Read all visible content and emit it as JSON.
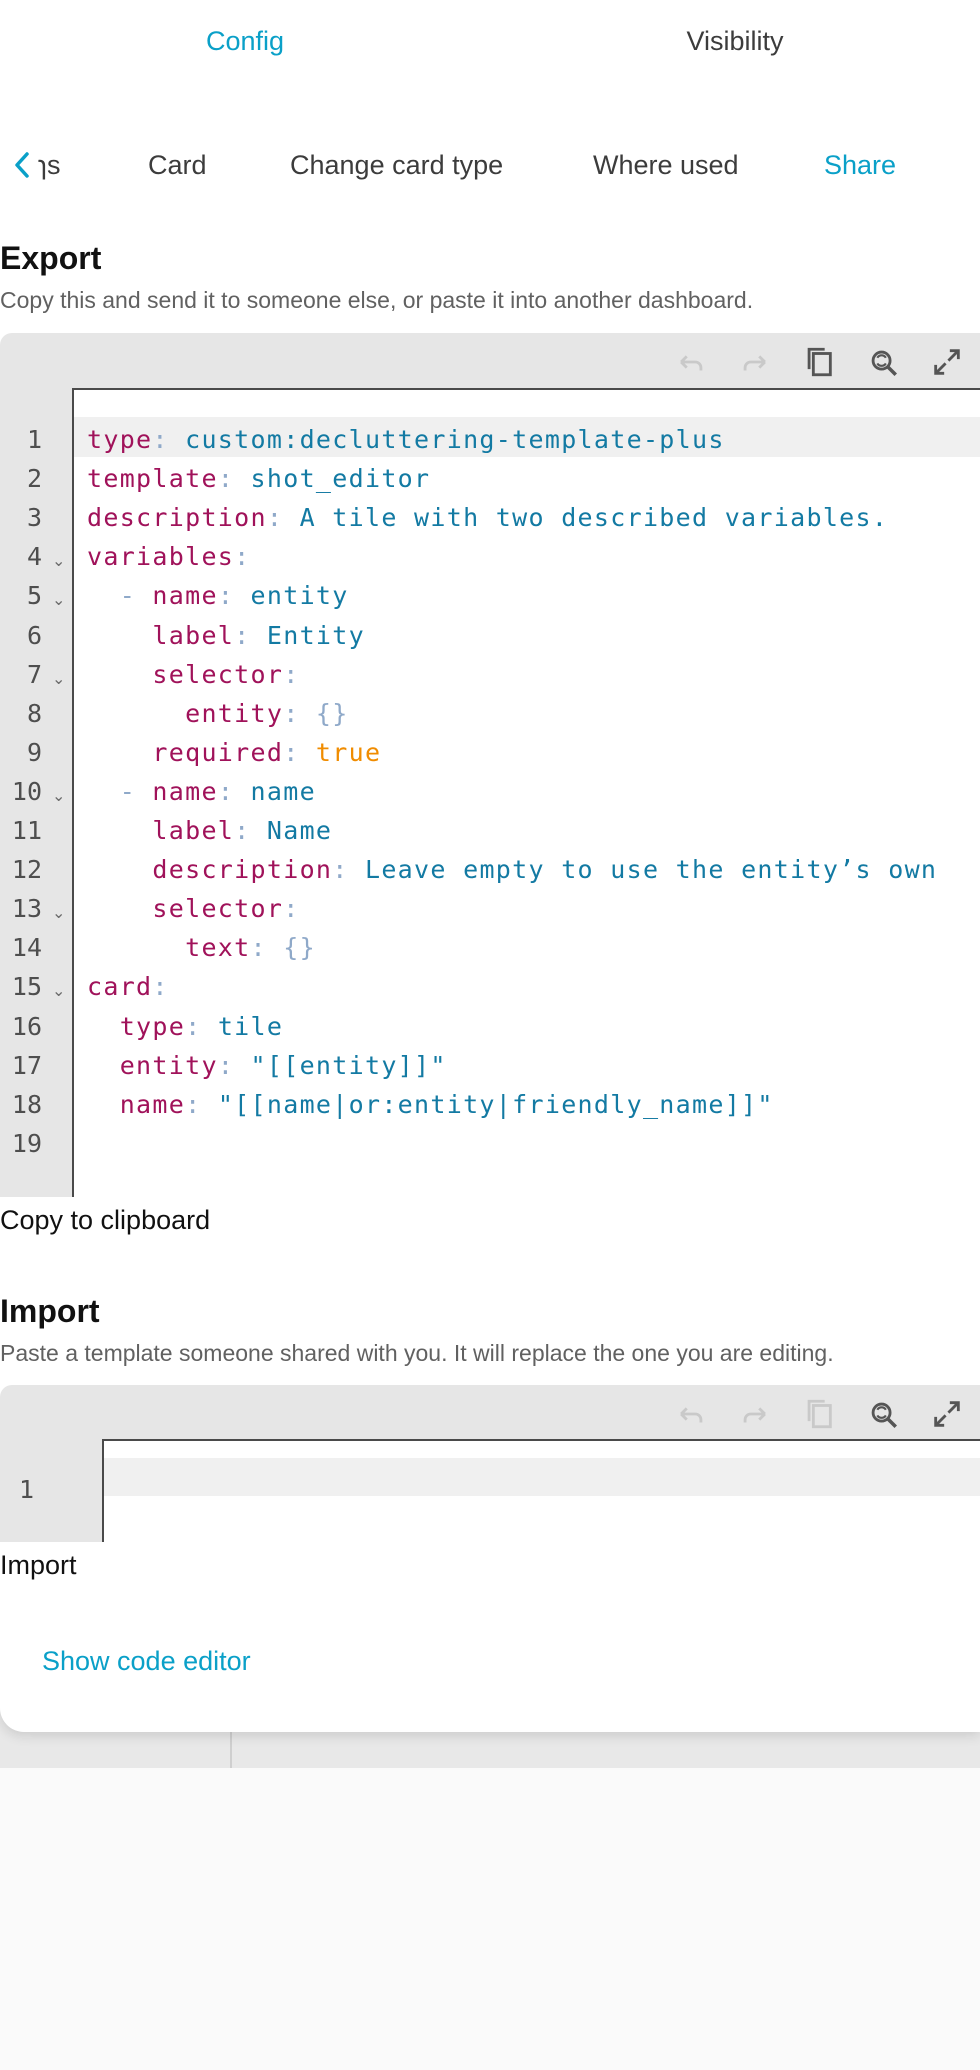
{
  "top_tabs": {
    "config": "Config",
    "visibility": "Visibility"
  },
  "sub_tabs": {
    "partial": "ɿs",
    "card": "Card",
    "change_type": "Change card type",
    "where_used": "Where used",
    "share": "Share"
  },
  "export": {
    "title": "Export",
    "description": "Copy this and send it to someone else, or paste it into another dashboard.",
    "copy_label": "Copy to clipboard",
    "toolbar_icons": [
      "undo-icon",
      "redo-icon",
      "copy-icon",
      "search-replace-icon",
      "fullscreen-icon"
    ],
    "lines": [
      {
        "n": "1",
        "fold": false,
        "parts": [
          [
            "k",
            "type"
          ],
          [
            "p",
            ": "
          ],
          [
            "s",
            "custom:decluttering-template-plus"
          ]
        ]
      },
      {
        "n": "2",
        "fold": false,
        "parts": [
          [
            "k",
            "template"
          ],
          [
            "p",
            ": "
          ],
          [
            "s",
            "shot_editor"
          ]
        ]
      },
      {
        "n": "3",
        "fold": false,
        "parts": [
          [
            "k",
            "description"
          ],
          [
            "p",
            ": "
          ],
          [
            "s",
            "A tile with two described variables."
          ]
        ]
      },
      {
        "n": "4",
        "fold": true,
        "parts": [
          [
            "k",
            "variables"
          ],
          [
            "p",
            ":"
          ]
        ]
      },
      {
        "n": "5",
        "fold": true,
        "parts": [
          [
            "p",
            "  - "
          ],
          [
            "k",
            "name"
          ],
          [
            "p",
            ": "
          ],
          [
            "s",
            "entity"
          ]
        ]
      },
      {
        "n": "6",
        "fold": false,
        "parts": [
          [
            "p",
            "    "
          ],
          [
            "k",
            "label"
          ],
          [
            "p",
            ": "
          ],
          [
            "s",
            "Entity"
          ]
        ]
      },
      {
        "n": "7",
        "fold": true,
        "parts": [
          [
            "p",
            "    "
          ],
          [
            "k",
            "selector"
          ],
          [
            "p",
            ":"
          ]
        ]
      },
      {
        "n": "8",
        "fold": false,
        "parts": [
          [
            "p",
            "      "
          ],
          [
            "k",
            "entity"
          ],
          [
            "p",
            ": {}"
          ]
        ]
      },
      {
        "n": "9",
        "fold": false,
        "parts": [
          [
            "p",
            "    "
          ],
          [
            "k",
            "required"
          ],
          [
            "p",
            ": "
          ],
          [
            "b",
            "true"
          ]
        ]
      },
      {
        "n": "10",
        "fold": true,
        "parts": [
          [
            "p",
            "  - "
          ],
          [
            "k",
            "name"
          ],
          [
            "p",
            ": "
          ],
          [
            "s",
            "name"
          ]
        ]
      },
      {
        "n": "11",
        "fold": false,
        "parts": [
          [
            "p",
            "    "
          ],
          [
            "k",
            "label"
          ],
          [
            "p",
            ": "
          ],
          [
            "s",
            "Name"
          ]
        ]
      },
      {
        "n": "12",
        "fold": false,
        "parts": [
          [
            "p",
            "    "
          ],
          [
            "k",
            "description"
          ],
          [
            "p",
            ": "
          ],
          [
            "s",
            "Leave empty to use the entity’s own"
          ]
        ]
      },
      {
        "n": "13",
        "fold": true,
        "parts": [
          [
            "p",
            "    "
          ],
          [
            "k",
            "selector"
          ],
          [
            "p",
            ":"
          ]
        ]
      },
      {
        "n": "14",
        "fold": false,
        "parts": [
          [
            "p",
            "      "
          ],
          [
            "k",
            "text"
          ],
          [
            "p",
            ": {}"
          ]
        ]
      },
      {
        "n": "15",
        "fold": true,
        "parts": [
          [
            "k",
            "card"
          ],
          [
            "p",
            ":"
          ]
        ]
      },
      {
        "n": "16",
        "fold": false,
        "parts": [
          [
            "p",
            "  "
          ],
          [
            "k",
            "type"
          ],
          [
            "p",
            ": "
          ],
          [
            "s",
            "tile"
          ]
        ]
      },
      {
        "n": "17",
        "fold": false,
        "parts": [
          [
            "p",
            "  "
          ],
          [
            "k",
            "entity"
          ],
          [
            "p",
            ": "
          ],
          [
            "s",
            "\"[[entity]]\""
          ]
        ]
      },
      {
        "n": "18",
        "fold": false,
        "parts": [
          [
            "p",
            "  "
          ],
          [
            "k",
            "name"
          ],
          [
            "p",
            ": "
          ],
          [
            "s",
            "\"[[name|or:entity|friendly_name]]\""
          ]
        ]
      },
      {
        "n": "19",
        "fold": false,
        "parts": []
      }
    ]
  },
  "import": {
    "title": "Import",
    "description": "Paste a template someone shared with you. It will replace the one you are editing.",
    "button_label": "Import",
    "line_number": "1",
    "toolbar_icons": [
      "undo-icon",
      "redo-icon",
      "copy-icon",
      "search-replace-icon",
      "fullscreen-icon"
    ]
  },
  "show_code_editor": "Show code editor",
  "colors": {
    "accent": "#0aa0c8",
    "yaml_key": "#a0125a",
    "yaml_string": "#137aa3",
    "yaml_bool": "#f08c00",
    "yaml_punct": "#8fa9c9"
  }
}
